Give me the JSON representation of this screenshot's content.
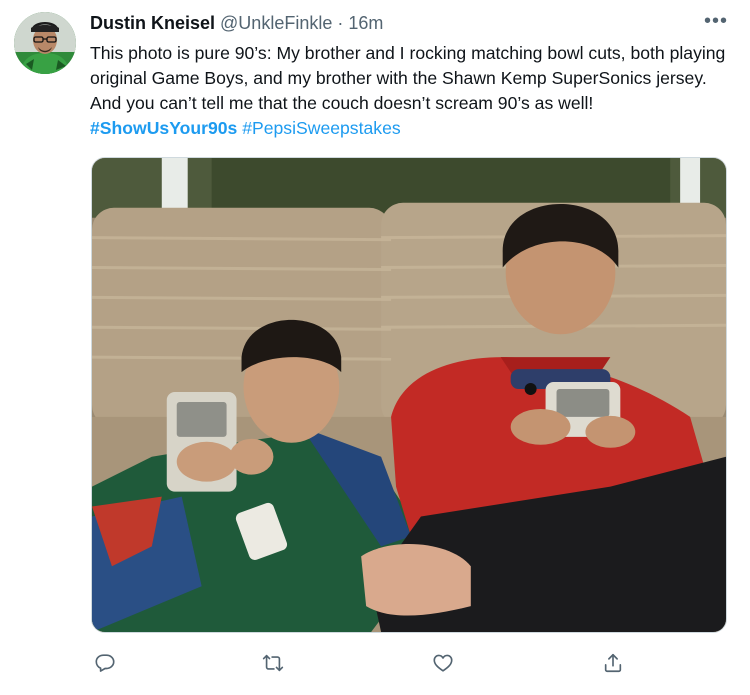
{
  "tweet": {
    "author": {
      "name": "Dustin Kneisel",
      "handle": "@UnkleFinkle",
      "separator": "·",
      "time": "16m",
      "avatar_icon": "user-avatar"
    },
    "more_icon": "more-horizontal-icon",
    "text_part1": "This photo is pure 90’s: My brother and I rocking matching bowl cuts, both playing original Game Boys, and my brother with the Shawn Kemp SuperSonics jersey. And you can’t tell me that the couch doesn’t scream 90’s as well! ",
    "hashtags": [
      "#ShowUsYour90s",
      "#PepsiSweepstakes"
    ],
    "media": {
      "type": "photo",
      "icon": "photo-two-boys-gameboys-on-couch"
    },
    "actions": [
      {
        "name": "reply",
        "icon": "reply-icon"
      },
      {
        "name": "retweet",
        "icon": "retweet-icon"
      },
      {
        "name": "like",
        "icon": "heart-icon"
      },
      {
        "name": "share",
        "icon": "share-icon"
      }
    ],
    "colors": {
      "text": "#0f1419",
      "secondary": "#536471",
      "link": "#1d9bf0",
      "border": "#cfd9de"
    }
  }
}
